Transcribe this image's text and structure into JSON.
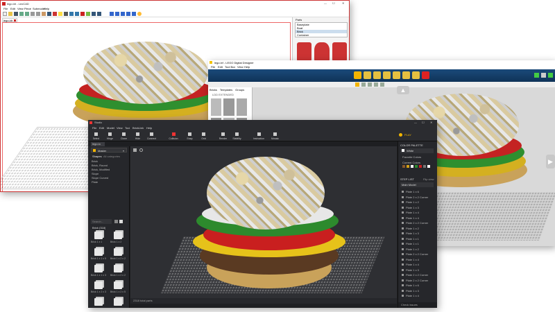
{
  "leocad": {
    "title": "lego.ldr - LeoCAD",
    "menu": [
      "File",
      "Edit",
      "View",
      "Piece",
      "Submodel",
      "Help"
    ],
    "tab": "lego.ldr",
    "parts_panel": {
      "title": "Parts",
      "categories": [
        "Baseplate",
        "Boat",
        "Brick",
        "Container"
      ]
    }
  },
  "ldd": {
    "title": "lego.lxf - LEGO Digital Designer",
    "menu": [
      "File",
      "Edit",
      "Tool Box",
      "View",
      "Help"
    ],
    "tabs": [
      "Bricks",
      "Templates",
      "Groups"
    ],
    "filter_label": "LDD EXTENDED"
  },
  "studio": {
    "title": "Studio",
    "menu": [
      "File",
      "Edit",
      "Model",
      "View",
      "Tool",
      "BrickLink",
      "Help"
    ],
    "toolbar": [
      "Select",
      "Hinge",
      "Clone",
      "Hide",
      "Connect",
      "Collision",
      "Snap",
      "Grid",
      "Render",
      "Stability",
      "Instruction",
      "Mosaic"
    ],
    "right_status": "PLAY",
    "tab": "lego.io",
    "palette_tab": "Master",
    "shapes_label": "Shapes",
    "shapes_value": "All categories",
    "shape_list": [
      "Brick",
      "Brick, Round",
      "Brick, Modified",
      "Slope",
      "Slope Curved",
      "Plate"
    ],
    "search_placeholder": "Search...",
    "brick_header": "Brick (318)",
    "brick_items": [
      "Brick 1 x 1",
      "Brick 1 x 2",
      "Brick 1 x 1 x 5",
      "Brick 1 x 2 x 2",
      "Brick 1 x 1 x 3",
      "Brick 1 x 2 x 2",
      "Brick 1 x 2 x 3",
      "Brick 1 x 2 x 5",
      "",
      ""
    ],
    "color_palette": {
      "title": "COLOR PALETTE",
      "selected": "White",
      "favorite": "Favorite Colors",
      "current": "Current Colors",
      "colors": [
        "#8b5a2b",
        "#d4a017",
        "#ffffff",
        "#2e8b2e",
        "#cc2222",
        "#777777",
        "#ffffff"
      ]
    },
    "step_list": {
      "title": "STEP LIST",
      "flip_label": "Flip view",
      "model": "Main Model",
      "steps": [
        "Plate 1 x 6",
        "Plate 2 x 2 Corner",
        "Plate 1 x 2",
        "Plate 1 x 3",
        "Plate 1 x 4",
        "Plate 1 x 4",
        "Plate 2 x 2 Corner",
        "Plate 1 x 2",
        "Plate 1 x 3",
        "Plate 1 x 1",
        "Plate 1 x 1",
        "Plate 1 x 2",
        "Plate 2 x 2 Corner",
        "Plate 1 x 4",
        "Plate 1 x 4",
        "Plate 1 x 3",
        "Plate 2 x 2 Corner",
        "Plate 2 x 2 Corner",
        "Plate 1 x 6",
        "Plate 1 x 3",
        "Plate 1 x 4"
      ],
      "footer": "Check issues"
    },
    "status": "2318 total parts"
  }
}
